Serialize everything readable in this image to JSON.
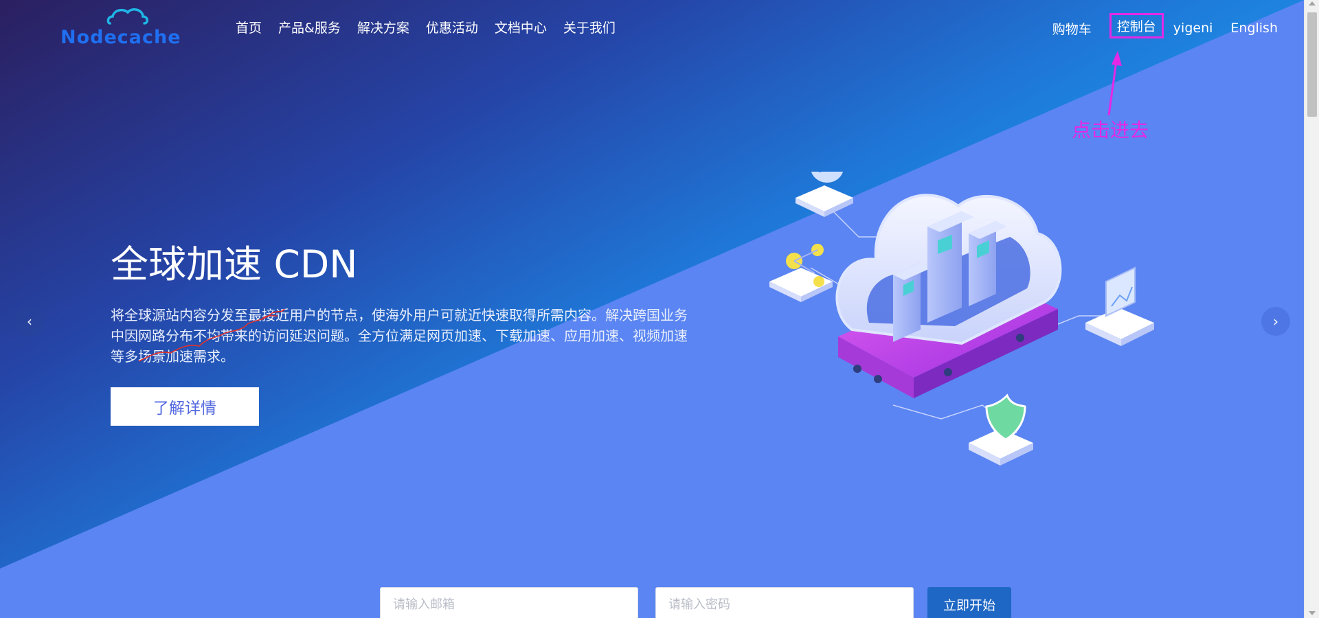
{
  "header": {
    "logo_text": "Nodecache",
    "nav": [
      "首页",
      "产品&服务",
      "解决方案",
      "优惠活动",
      "文档中心",
      "关于我们"
    ],
    "right": {
      "cart": "购物车",
      "console": "控制台",
      "user": "yigeni",
      "language": "English"
    }
  },
  "annotation": {
    "text": "点击进去",
    "color": "#e528e6"
  },
  "hero": {
    "title": "全球加速 CDN",
    "description": "将全球源站内容分发至最接近用户的节点，使海外用户可就近快速取得所需内容。解决跨国业务中因网路分布不均带来的访问延迟问题。全方位满足网页加速、下载加速、应用加速、视频加速等多场景加速需求。",
    "cta": "了解详情",
    "prev_icon": "‹",
    "next_icon": "›"
  },
  "signup": {
    "email_placeholder": "请输入邮箱",
    "password_placeholder": "请输入密码",
    "submit": "立即开始"
  },
  "colors": {
    "brand": "#1f6ff0",
    "hero_light": "#5a85f2",
    "hero_dark": "#2b1f60",
    "cta_text": "#5268e0",
    "start_button": "#1f67c4"
  }
}
